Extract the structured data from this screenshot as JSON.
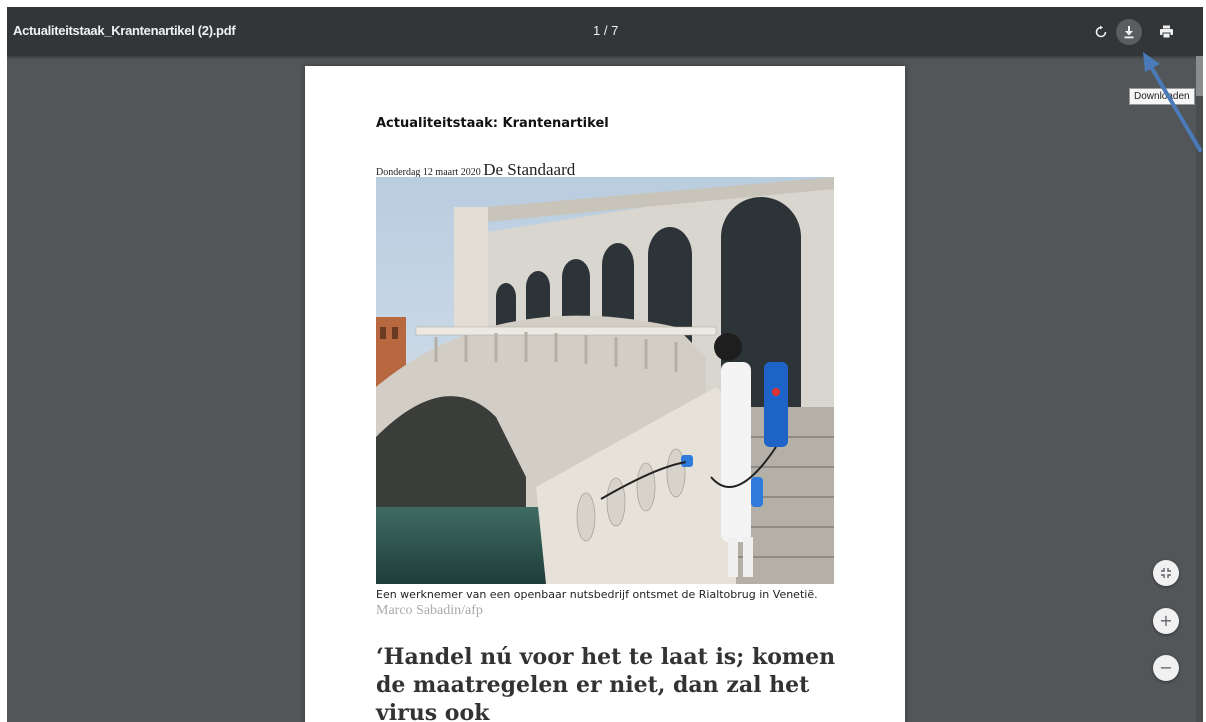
{
  "toolbar": {
    "title": "Actualiteitstaak_Krantenartikel (2).pdf",
    "page_indicator": "1 / 7",
    "rotate_icon": "rotate-icon",
    "download_icon": "download-icon",
    "print_icon": "print-icon",
    "download_tooltip": "Downloaden"
  },
  "document": {
    "heading": "Actualiteitstaak: Krantenartikel",
    "dateline_date": "Donderdag 12 maart 2020",
    "dateline_paper": "De Standaard",
    "photo_alt": "Een werknemer ontsmet de Rialtobrug in Venetië",
    "caption": "Een werknemer van een openbaar nutsbedrijf ontsmet de Rialtobrug in Venetië.",
    "credit": "Marco Sabadin/afp",
    "headline": "‘Handel nú voor het te laat is; komen de maatregelen er niet, dan zal het virus ook"
  },
  "zoom_controls": {
    "fit_icon": "fit-to-page-icon",
    "zoom_in_label": "+",
    "zoom_out_label": "−"
  },
  "colors": {
    "toolbar": "#323639",
    "viewer_background": "#525659",
    "annotation_arrow": "#4a7ab8"
  }
}
